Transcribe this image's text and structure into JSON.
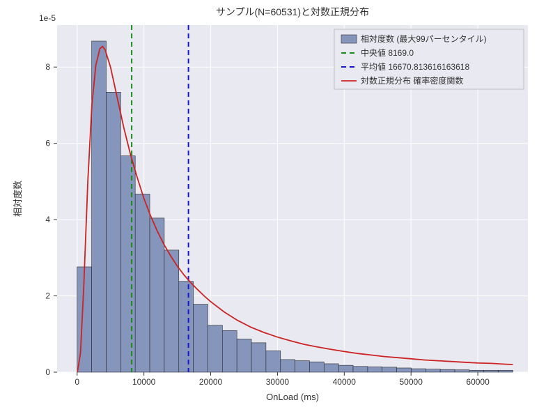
{
  "chart_data": {
    "type": "bar",
    "title": "サンプル(N=60531)と対数正規分布",
    "xlabel": "OnLoad (ms)",
    "ylabel": "相対度数",
    "y_exponent_label": "1e-5",
    "xlim": [
      -3000,
      67500
    ],
    "ylim": [
      0,
      9.1e-05
    ],
    "xticks": [
      0,
      10000,
      20000,
      30000,
      40000,
      50000,
      60000
    ],
    "yticks": [
      0,
      2,
      4,
      6,
      8
    ],
    "bin_edges": [
      0,
      2175,
      4350,
      6525,
      8700,
      10875,
      13050,
      15225,
      17400,
      19575,
      21750,
      23925,
      26100,
      28275,
      30450,
      32625,
      34800,
      36975,
      39150,
      41325,
      43500,
      45675,
      47850,
      50025,
      52200,
      54375,
      56550,
      58725,
      60900,
      63075,
      65250
    ],
    "bar_values_e5": [
      2.76,
      8.68,
      7.34,
      5.67,
      4.67,
      4.04,
      3.2,
      2.38,
      1.78,
      1.23,
      1.09,
      0.87,
      0.77,
      0.56,
      0.33,
      0.3,
      0.27,
      0.22,
      0.18,
      0.15,
      0.14,
      0.13,
      0.11,
      0.09,
      0.08,
      0.07,
      0.06,
      0.05,
      0.05,
      0.05
    ],
    "median": 8169.0,
    "mean": 16670.813616163618,
    "pdf_curve_e5": [
      [
        40,
        0.0
      ],
      [
        500,
        0.5
      ],
      [
        1000,
        2.3
      ],
      [
        1600,
        5.0
      ],
      [
        2200,
        7.0
      ],
      [
        2800,
        8.05
      ],
      [
        3400,
        8.48
      ],
      [
        3800,
        8.54
      ],
      [
        4200,
        8.45
      ],
      [
        5000,
        8.0
      ],
      [
        6000,
        7.2
      ],
      [
        7000,
        6.4
      ],
      [
        8000,
        5.7
      ],
      [
        9000,
        5.1
      ],
      [
        10000,
        4.55
      ],
      [
        11000,
        4.1
      ],
      [
        12000,
        3.7
      ],
      [
        13000,
        3.35
      ],
      [
        14000,
        3.05
      ],
      [
        15000,
        2.78
      ],
      [
        16000,
        2.55
      ],
      [
        17000,
        2.35
      ],
      [
        18000,
        2.17
      ],
      [
        19000,
        2.0
      ],
      [
        20000,
        1.85
      ],
      [
        22000,
        1.58
      ],
      [
        24000,
        1.36
      ],
      [
        26000,
        1.18
      ],
      [
        28000,
        1.04
      ],
      [
        30000,
        0.92
      ],
      [
        32000,
        0.82
      ],
      [
        34000,
        0.73
      ],
      [
        36000,
        0.66
      ],
      [
        38000,
        0.6
      ],
      [
        40000,
        0.54
      ],
      [
        42000,
        0.49
      ],
      [
        44000,
        0.45
      ],
      [
        46000,
        0.41
      ],
      [
        48000,
        0.38
      ],
      [
        50000,
        0.35
      ],
      [
        52000,
        0.32
      ],
      [
        54000,
        0.3
      ],
      [
        56000,
        0.28
      ],
      [
        58000,
        0.26
      ],
      [
        60000,
        0.24
      ],
      [
        62000,
        0.23
      ],
      [
        64000,
        0.21
      ],
      [
        65250,
        0.2
      ]
    ],
    "legend": {
      "hist": "相対度数 (最大99パーセンタイル)",
      "median": "中央値 8169.0",
      "mean": "平均値 16670.813616163618",
      "pdf": "対数正規分布 確率密度関数"
    }
  }
}
